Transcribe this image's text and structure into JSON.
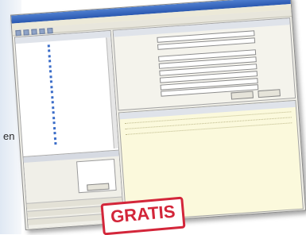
{
  "edge": {
    "text": "en"
  },
  "window": {
    "title": "",
    "menu": [
      "",
      "",
      "",
      "",
      ""
    ],
    "tree": {
      "header": "",
      "items": [
        "",
        "",
        "",
        "",
        "",
        "",
        "",
        "",
        "",
        "",
        "",
        "",
        "",
        "",
        "",
        "",
        "",
        "",
        "",
        ""
      ]
    },
    "left_bottom": {
      "header": "",
      "panel": [
        "",
        "",
        ""
      ],
      "box": [
        "",
        "",
        ""
      ],
      "button": "",
      "bar1": "",
      "bar2": "",
      "bar3": ""
    },
    "form": {
      "header": "",
      "rows": [
        {
          "label": "",
          "value": ""
        },
        {
          "label": "",
          "value": ""
        },
        {
          "label": "",
          "value": ""
        },
        {
          "label": "",
          "value": ""
        },
        {
          "label": "",
          "value": ""
        },
        {
          "label": "",
          "value": ""
        },
        {
          "label": "",
          "value": ""
        },
        {
          "label": "",
          "value": ""
        }
      ],
      "button1": "",
      "button2": ""
    },
    "log": {
      "header": "",
      "blocks": [
        [
          "",
          "",
          "",
          ""
        ],
        [
          "",
          "",
          "",
          ""
        ],
        [
          "",
          "",
          "",
          ""
        ]
      ]
    }
  },
  "badge": {
    "text": "GRATIS",
    "color": "#d3263a"
  }
}
